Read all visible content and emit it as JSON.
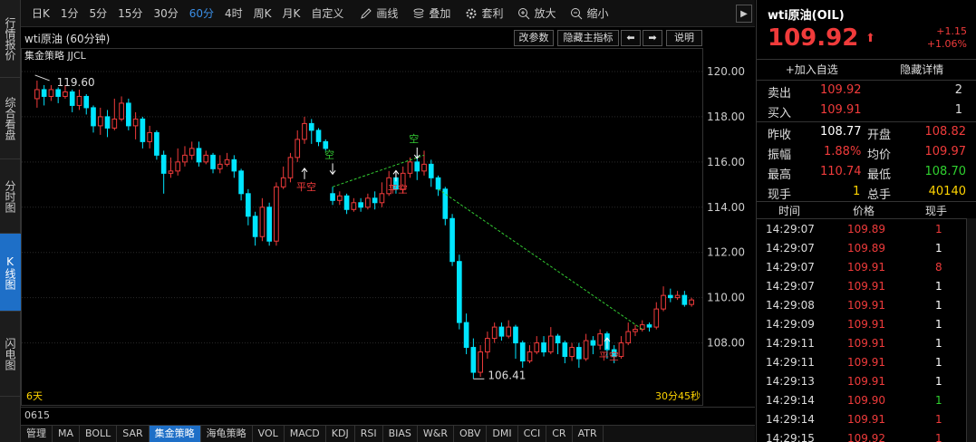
{
  "side_tabs": [
    {
      "label": "行情报价",
      "active": false
    },
    {
      "label": "综合看盘",
      "active": false
    },
    {
      "label": "分时图",
      "active": false
    },
    {
      "label": "K线图",
      "active": true
    },
    {
      "label": "闪电图",
      "active": false
    }
  ],
  "toolbar": {
    "periods": [
      {
        "label": "日K",
        "active": false
      },
      {
        "label": "1分",
        "active": false
      },
      {
        "label": "5分",
        "active": false
      },
      {
        "label": "15分",
        "active": false
      },
      {
        "label": "30分",
        "active": false
      },
      {
        "label": "60分",
        "active": true
      },
      {
        "label": "4时",
        "active": false
      },
      {
        "label": "周K",
        "active": false
      },
      {
        "label": "月K",
        "active": false
      },
      {
        "label": "自定义",
        "active": false
      }
    ],
    "tools": [
      {
        "label": "画线",
        "icon": "pencil-icon"
      },
      {
        "label": "叠加",
        "icon": "stack-icon"
      },
      {
        "label": "套利",
        "icon": "gear-icon"
      },
      {
        "label": "放大",
        "icon": "zoom-in-icon"
      },
      {
        "label": "缩小",
        "icon": "zoom-out-icon"
      }
    ]
  },
  "chart_header": {
    "title": "wti原油 (60分钟)",
    "strategy": "集金策略 JJCL",
    "buttons": {
      "params": "改参数",
      "hide": "隐藏主指标",
      "left": "⬅",
      "right": "➡",
      "help": "说明"
    }
  },
  "chart_data": {
    "type": "candlestick",
    "ylim": [
      105.5,
      120.8
    ],
    "yticks": [
      120.0,
      118.0,
      116.0,
      114.0,
      112.0,
      110.0,
      108.0
    ],
    "high_label": "119.60",
    "low_label": "106.41",
    "period_label": "6天",
    "countdown": "30分45秒",
    "signals": [
      "平空",
      "空",
      "平空",
      "空",
      "平空"
    ],
    "candles": [
      [
        118.8,
        119.2,
        119.6,
        118.4
      ],
      [
        119.2,
        118.9,
        119.4,
        118.5
      ],
      [
        118.9,
        119.2,
        119.4,
        118.7
      ],
      [
        119.2,
        118.9,
        119.3,
        118.6
      ],
      [
        118.9,
        119.1,
        119.4,
        118.8
      ],
      [
        119.1,
        118.5,
        119.2,
        118.2
      ],
      [
        118.5,
        118.9,
        119.2,
        118.3
      ],
      [
        118.9,
        118.4,
        119.0,
        118.1
      ],
      [
        118.4,
        117.6,
        118.5,
        117.3
      ],
      [
        117.6,
        118.0,
        118.4,
        117.2
      ],
      [
        118.0,
        117.5,
        118.3,
        117.1
      ],
      [
        117.5,
        117.9,
        118.8,
        117.4
      ],
      [
        117.9,
        118.6,
        118.9,
        117.8
      ],
      [
        118.6,
        117.6,
        118.8,
        117.4
      ],
      [
        117.6,
        117.9,
        118.2,
        117.0
      ],
      [
        117.9,
        116.9,
        118.0,
        116.6
      ],
      [
        116.9,
        117.3,
        117.6,
        116.6
      ],
      [
        117.3,
        116.3,
        117.4,
        116.1
      ],
      [
        116.3,
        115.5,
        116.5,
        114.6
      ],
      [
        115.5,
        115.6,
        116.2,
        115.3
      ],
      [
        115.6,
        116.0,
        116.6,
        115.4
      ],
      [
        116.0,
        116.3,
        116.7,
        115.8
      ],
      [
        116.3,
        116.6,
        116.9,
        116.1
      ],
      [
        116.6,
        116.0,
        116.9,
        115.8
      ],
      [
        116.0,
        116.3,
        116.5,
        115.9
      ],
      [
        116.3,
        115.7,
        116.4,
        115.5
      ],
      [
        115.7,
        115.9,
        116.3,
        115.5
      ],
      [
        115.9,
        116.1,
        116.4,
        115.8
      ],
      [
        116.1,
        115.6,
        116.3,
        115.3
      ],
      [
        115.6,
        114.6,
        115.7,
        114.3
      ],
      [
        114.6,
        113.6,
        114.8,
        113.2
      ],
      [
        113.6,
        112.7,
        113.8,
        112.3
      ],
      [
        112.7,
        114.0,
        114.4,
        112.5
      ],
      [
        114.0,
        112.5,
        114.2,
        112.3
      ],
      [
        112.5,
        114.9,
        115.1,
        112.3
      ],
      [
        114.9,
        115.3,
        115.8,
        114.8
      ],
      [
        115.3,
        116.2,
        116.4,
        115.1
      ],
      [
        116.2,
        117.0,
        117.4,
        116.0
      ],
      [
        117.0,
        117.7,
        118.0,
        116.8
      ],
      [
        117.7,
        117.4,
        117.9,
        116.8
      ],
      [
        117.4,
        116.9,
        117.5,
        116.7
      ],
      [
        116.9,
        116.6,
        117.0,
        116.5
      ],
      [
        114.6,
        114.3,
        114.9,
        114.1
      ],
      [
        114.3,
        114.5,
        114.7,
        114.1
      ],
      [
        114.5,
        113.9,
        114.6,
        113.7
      ],
      [
        113.9,
        114.2,
        114.4,
        113.8
      ],
      [
        114.2,
        114.0,
        114.4,
        113.8
      ],
      [
        114.0,
        114.4,
        114.6,
        113.9
      ],
      [
        114.4,
        114.2,
        114.7,
        113.9
      ],
      [
        114.2,
        114.6,
        115.1,
        114.0
      ],
      [
        114.6,
        115.3,
        115.6,
        114.5
      ],
      [
        115.3,
        114.8,
        115.5,
        114.6
      ],
      [
        114.8,
        115.5,
        115.8,
        114.6
      ],
      [
        115.5,
        116.0,
        116.2,
        115.3
      ],
      [
        116.0,
        115.6,
        116.3,
        115.2
      ],
      [
        115.6,
        115.9,
        116.5,
        115.4
      ],
      [
        115.9,
        115.3,
        116.1,
        114.9
      ],
      [
        115.3,
        114.8,
        115.4,
        114.5
      ],
      [
        114.8,
        113.5,
        114.9,
        113.2
      ],
      [
        113.5,
        111.6,
        113.7,
        111.4
      ],
      [
        111.6,
        108.9,
        111.9,
        108.6
      ],
      [
        108.9,
        107.8,
        109.3,
        107.5
      ],
      [
        107.8,
        106.7,
        108.2,
        106.41
      ],
      [
        106.7,
        107.6,
        107.9,
        106.5
      ],
      [
        107.6,
        108.2,
        108.5,
        107.3
      ],
      [
        108.2,
        108.7,
        108.9,
        108.0
      ],
      [
        108.7,
        108.3,
        108.9,
        108.1
      ],
      [
        108.3,
        108.7,
        109.0,
        108.2
      ],
      [
        108.7,
        108.0,
        108.8,
        107.3
      ],
      [
        108.0,
        107.2,
        108.1,
        106.9
      ],
      [
        107.2,
        107.6,
        107.9,
        107.1
      ],
      [
        107.6,
        108.0,
        108.3,
        107.5
      ],
      [
        108.0,
        107.6,
        108.3,
        107.4
      ],
      [
        107.6,
        108.3,
        108.7,
        107.5
      ],
      [
        108.3,
        108.0,
        108.4,
        107.5
      ],
      [
        108.0,
        107.4,
        108.1,
        107.1
      ],
      [
        107.4,
        107.8,
        108.0,
        107.2
      ],
      [
        107.8,
        107.3,
        108.0,
        106.9
      ],
      [
        107.3,
        108.1,
        108.4,
        107.2
      ],
      [
        108.1,
        107.9,
        108.3,
        107.5
      ],
      [
        107.9,
        108.4,
        108.6,
        107.7
      ],
      [
        108.4,
        107.7,
        108.5,
        107.3
      ],
      [
        107.7,
        107.4,
        107.9,
        107.1
      ],
      [
        107.4,
        108.0,
        108.3,
        107.3
      ],
      [
        108.0,
        108.5,
        108.9,
        107.9
      ],
      [
        108.5,
        108.6,
        108.8,
        108.3
      ],
      [
        108.6,
        108.8,
        109.0,
        108.5
      ],
      [
        108.8,
        108.7,
        108.9,
        108.5
      ],
      [
        108.7,
        109.5,
        109.8,
        108.6
      ],
      [
        109.5,
        110.1,
        110.5,
        109.4
      ],
      [
        110.1,
        110.0,
        110.4,
        109.8
      ],
      [
        110.0,
        110.1,
        110.3,
        109.9
      ],
      [
        110.1,
        109.7,
        110.3,
        109.6
      ],
      [
        109.7,
        109.9,
        110.0,
        109.6
      ]
    ]
  },
  "bottom": {
    "indicator_value": "0615",
    "tabs": [
      {
        "label": "管理",
        "active": false
      },
      {
        "label": "MA",
        "active": false
      },
      {
        "label": "BOLL",
        "active": false
      },
      {
        "label": "SAR",
        "active": false
      },
      {
        "label": "集金策略",
        "active": true
      },
      {
        "label": "海龟策略",
        "active": false
      },
      {
        "label": "VOL",
        "active": false
      },
      {
        "label": "MACD",
        "active": false
      },
      {
        "label": "KDJ",
        "active": false
      },
      {
        "label": "RSI",
        "active": false
      },
      {
        "label": "BIAS",
        "active": false
      },
      {
        "label": "W&R",
        "active": false
      },
      {
        "label": "OBV",
        "active": false
      },
      {
        "label": "DMI",
        "active": false
      },
      {
        "label": "CCI",
        "active": false
      },
      {
        "label": "CR",
        "active": false
      },
      {
        "label": "ATR",
        "active": false
      }
    ]
  },
  "quote": {
    "name": "wti原油(OIL)",
    "price": "109.92",
    "change": "+1.15",
    "change_pct": "+1.06%",
    "add_watch": "+加入自选",
    "hide_detail": "隐藏详情",
    "sell": {
      "label": "卖出",
      "price": "109.92",
      "vol": "2"
    },
    "buy": {
      "label": "买入",
      "price": "109.91",
      "vol": "1"
    },
    "prev_close": {
      "label": "昨收",
      "value": "108.77"
    },
    "open": {
      "label": "开盘",
      "value": "108.82"
    },
    "amplitude": {
      "label": "振幅",
      "value": "1.88%"
    },
    "avg": {
      "label": "均价",
      "value": "109.97"
    },
    "high": {
      "label": "最高",
      "value": "110.74"
    },
    "low": {
      "label": "最低",
      "value": "108.70"
    },
    "cur_vol": {
      "label": "现手",
      "value": "1"
    },
    "total_vol": {
      "label": "总手",
      "value": "40140"
    },
    "ticks_header": {
      "time": "时间",
      "price": "价格",
      "vol": "现手"
    },
    "ticks": [
      {
        "time": "14:29:07",
        "price": "109.89",
        "vol": "1",
        "vc": "#f03b3b"
      },
      {
        "time": "14:29:07",
        "price": "109.89",
        "vol": "1",
        "vc": "#ffffff"
      },
      {
        "time": "14:29:07",
        "price": "109.91",
        "vol": "8",
        "vc": "#f03b3b"
      },
      {
        "time": "14:29:07",
        "price": "109.91",
        "vol": "1",
        "vc": "#ffffff"
      },
      {
        "time": "14:29:08",
        "price": "109.91",
        "vol": "1",
        "vc": "#ffffff"
      },
      {
        "time": "14:29:09",
        "price": "109.91",
        "vol": "1",
        "vc": "#ffffff"
      },
      {
        "time": "14:29:11",
        "price": "109.91",
        "vol": "1",
        "vc": "#ffffff"
      },
      {
        "time": "14:29:11",
        "price": "109.91",
        "vol": "1",
        "vc": "#ffffff"
      },
      {
        "time": "14:29:13",
        "price": "109.91",
        "vol": "1",
        "vc": "#ffffff"
      },
      {
        "time": "14:29:14",
        "price": "109.90",
        "vol": "1",
        "vc": "#2fd12f"
      },
      {
        "time": "14:29:14",
        "price": "109.91",
        "vol": "1",
        "vc": "#f03b3b"
      },
      {
        "time": "14:29:15",
        "price": "109.92",
        "vol": "1",
        "vc": "#f03b3b"
      }
    ]
  },
  "colors": {
    "up": "#f03b3b",
    "down": "#00e5ff",
    "accent": "#1e6fc7",
    "signal_line": "#33cc33"
  }
}
